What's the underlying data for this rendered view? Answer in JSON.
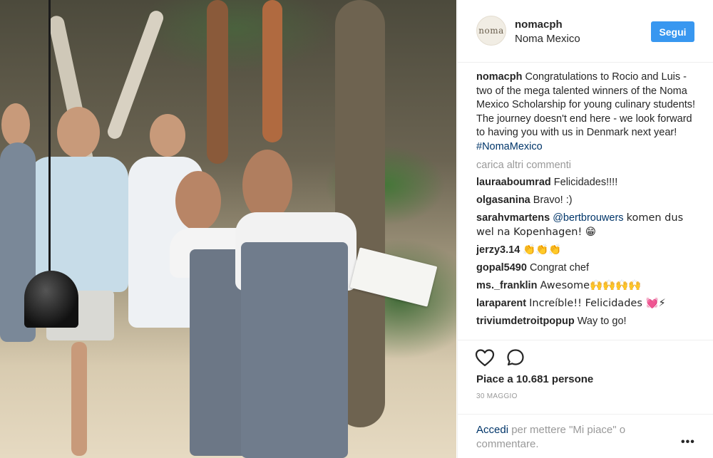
{
  "post": {
    "username": "nomacph",
    "location": "Noma Mexico",
    "avatar_text": "noma",
    "follow_label": "Segui",
    "caption_user": "nomacph",
    "caption_text": "Congratulations to Rocio and Luis - two of the mega talented winners of the Noma Mexico Scholarship for young culinary students! The journey doesn't end here - we look forward to having you with us in Denmark next year!",
    "caption_hashtag": "#NomaMexico",
    "load_more": "carica altri commenti",
    "likes": "Piace a 10.681 persone",
    "date": "30 MAGGIO",
    "login_link": "Accedi",
    "login_text": "per mettere \"Mi piace\" o commentare.",
    "more_symbol": "•••"
  },
  "comments": [
    {
      "user": "lauraaboumrad",
      "text": "Felicidades!!!!"
    },
    {
      "user": "olgasanina",
      "text": "Bravo! :)"
    },
    {
      "user": "sarahvmartens",
      "mention": "@bertbrouwers",
      "text": "komen dus wel na Kopenhagen! 😁"
    },
    {
      "user": "jerzy3.14",
      "text": "👏👏👏"
    },
    {
      "user": "gopal5490",
      "text": "Congrat chef"
    },
    {
      "user": "ms._franklin",
      "text": "Awesome🙌🙌🙌🙌"
    },
    {
      "user": "laraparent",
      "text": "Increíble!! Felicidades 💓⚡"
    },
    {
      "user": "triviumdetroitpopup",
      "text": "Way to go!"
    }
  ],
  "colors": {
    "follow_button": "#3897f0",
    "link": "#003569",
    "muted": "#999999"
  },
  "icons": {
    "like": "heart-outline-icon",
    "comment": "speech-bubble-icon",
    "more": "ellipsis-icon"
  }
}
